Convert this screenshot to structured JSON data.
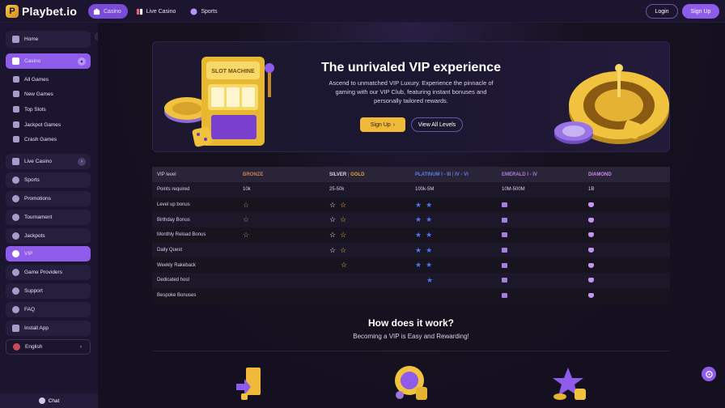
{
  "app": {
    "logo_text": "Playbet.io",
    "logo_letter": "P"
  },
  "topnav": {
    "tabs": [
      {
        "label": "Casino",
        "icon": "casino-icon",
        "active": true
      },
      {
        "label": "Live Casino",
        "icon": "live-casino-icon",
        "active": false
      },
      {
        "label": "Sports",
        "icon": "sports-icon",
        "active": false
      }
    ]
  },
  "auth": {
    "login": "Login",
    "signup": "Sign Up"
  },
  "sidebar": {
    "home": "Home",
    "casino": "Casino",
    "casino_subitems": [
      "All Games",
      "New Games",
      "Top Slots",
      "Jackpot Games",
      "Crash Games"
    ],
    "live_casino": "Live Casino",
    "items": [
      "Sports",
      "Promotions",
      "Tournament",
      "Jackpots",
      "VIP",
      "Game Providers",
      "Support",
      "FAQ",
      "Install App"
    ],
    "language": "English",
    "chat": "Chat"
  },
  "hero": {
    "title": "The unrivaled VIP experience",
    "description": "Ascend to unmatched VIP Luxury. Experience the pinnacle of gaming with our VIP Club, featuring instant bonuses and personally tailored rewards.",
    "signup": "Sign Up",
    "view_levels": "View All Levels",
    "slot_sign": "SLOT MACHINE"
  },
  "table": {
    "headers": {
      "level": "VIP level",
      "bronze": "BRONZE",
      "silver": "SILVER",
      "separator": "|",
      "gold": "GOLD",
      "platinum": "PLATINUM I - III",
      "platinum2": "IV - VI",
      "emerald": "EMERALD I - IV",
      "diamond": "DIAMOND"
    },
    "points_row": {
      "label": "Points required",
      "bronze": "10k",
      "silver": "25-50k",
      "platinum": "100k-5M",
      "emerald": "10M-500M",
      "diamond": "1B"
    },
    "rows": [
      {
        "label": "Level up bonus",
        "bronze": 1,
        "silver": 2,
        "platinum": 2,
        "emerald": 1,
        "diamond": 1
      },
      {
        "label": "Birthday Bonus",
        "bronze": 1,
        "silver": 2,
        "platinum": 2,
        "emerald": 1,
        "diamond": 1
      },
      {
        "label": "Monthly Reload Bonus",
        "bronze": 1,
        "silver": 2,
        "platinum": 2,
        "emerald": 1,
        "diamond": 1
      },
      {
        "label": "Daily Quest",
        "bronze": 0,
        "silver": 2,
        "platinum": 2,
        "emerald": 1,
        "diamond": 1
      },
      {
        "label": "Weekly Rakeback",
        "bronze": 0,
        "silver": 1,
        "platinum": 2,
        "emerald": 1,
        "diamond": 1
      },
      {
        "label": "Dedicated host",
        "bronze": 0,
        "silver": 0,
        "platinum": 1,
        "emerald": 1,
        "diamond": 1
      },
      {
        "label": "Bespoke Bonuses",
        "bronze": 0,
        "silver": 0,
        "platinum": 0,
        "emerald": 1,
        "diamond": 1
      }
    ]
  },
  "how": {
    "title": "How does it work?",
    "subtitle": "Becoming a VIP is Easy and Rewarding!"
  },
  "colors": {
    "accent": "#8e5bea",
    "gold": "#f0b93a",
    "bronze": "#d08a4a",
    "platinum": "#4c76f0",
    "emerald": "#a57ee0",
    "diamond": "#c494f0"
  }
}
